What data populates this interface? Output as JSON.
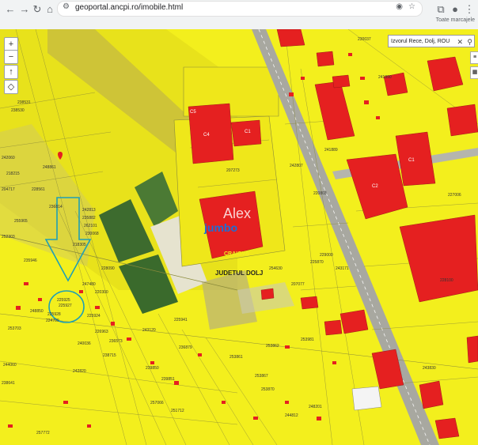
{
  "browser": {
    "url": "geoportal.ancpi.ro/imobile.html",
    "bookmarks_label": "Toate marcajele",
    "back_icon": "arrow-left-icon",
    "forward_icon": "arrow-right-icon",
    "reload_icon": "reload-icon",
    "home_icon": "home-icon"
  },
  "map_controls": {
    "zoom_in": "+",
    "zoom_out": "−",
    "north": "↑",
    "extent": "◇"
  },
  "search": {
    "value": "Izvorul Rece, Dolj, ROU"
  },
  "labels": {
    "watermark": "Alex",
    "store": "jumbo",
    "city": "CRAIOVA",
    "county": "JUDETUL DOLJ",
    "c4": "C4",
    "c1a": "C1",
    "c1b": "C1",
    "c2": "C2",
    "c5": "C5"
  },
  "parcel_numbers": [
    "230037",
    "238531",
    "238530",
    "242060",
    "248861",
    "218215",
    "228561",
    "236814",
    "242813",
    "235882",
    "262101",
    "230068",
    "225925",
    "225927",
    "225928",
    "248850",
    "252303",
    "235946",
    "225924",
    "224709",
    "226963",
    "236573",
    "238715",
    "225941",
    "241890",
    "241889",
    "228100",
    "254630",
    "253861",
    "253862",
    "253867",
    "253870",
    "248201",
    "244812",
    "251712",
    "257772",
    "239850",
    "239851",
    "240036",
    "253981",
    "207077",
    "243120",
    "244060",
    "242820",
    "218305",
    "228090",
    "225870",
    "229000",
    "243171",
    "242807",
    "220803",
    "227006",
    "207273",
    "220300",
    "253703",
    "257066",
    "236879",
    "255965",
    "238641",
    "204717",
    "243830",
    "247480"
  ],
  "colors": {
    "parcel_fill": "#f3ef1d",
    "building_fill": "#e52020",
    "parcel_line": "#8a8a3a",
    "annotation": "#1fa0b5",
    "road": "#a8a8a0"
  }
}
